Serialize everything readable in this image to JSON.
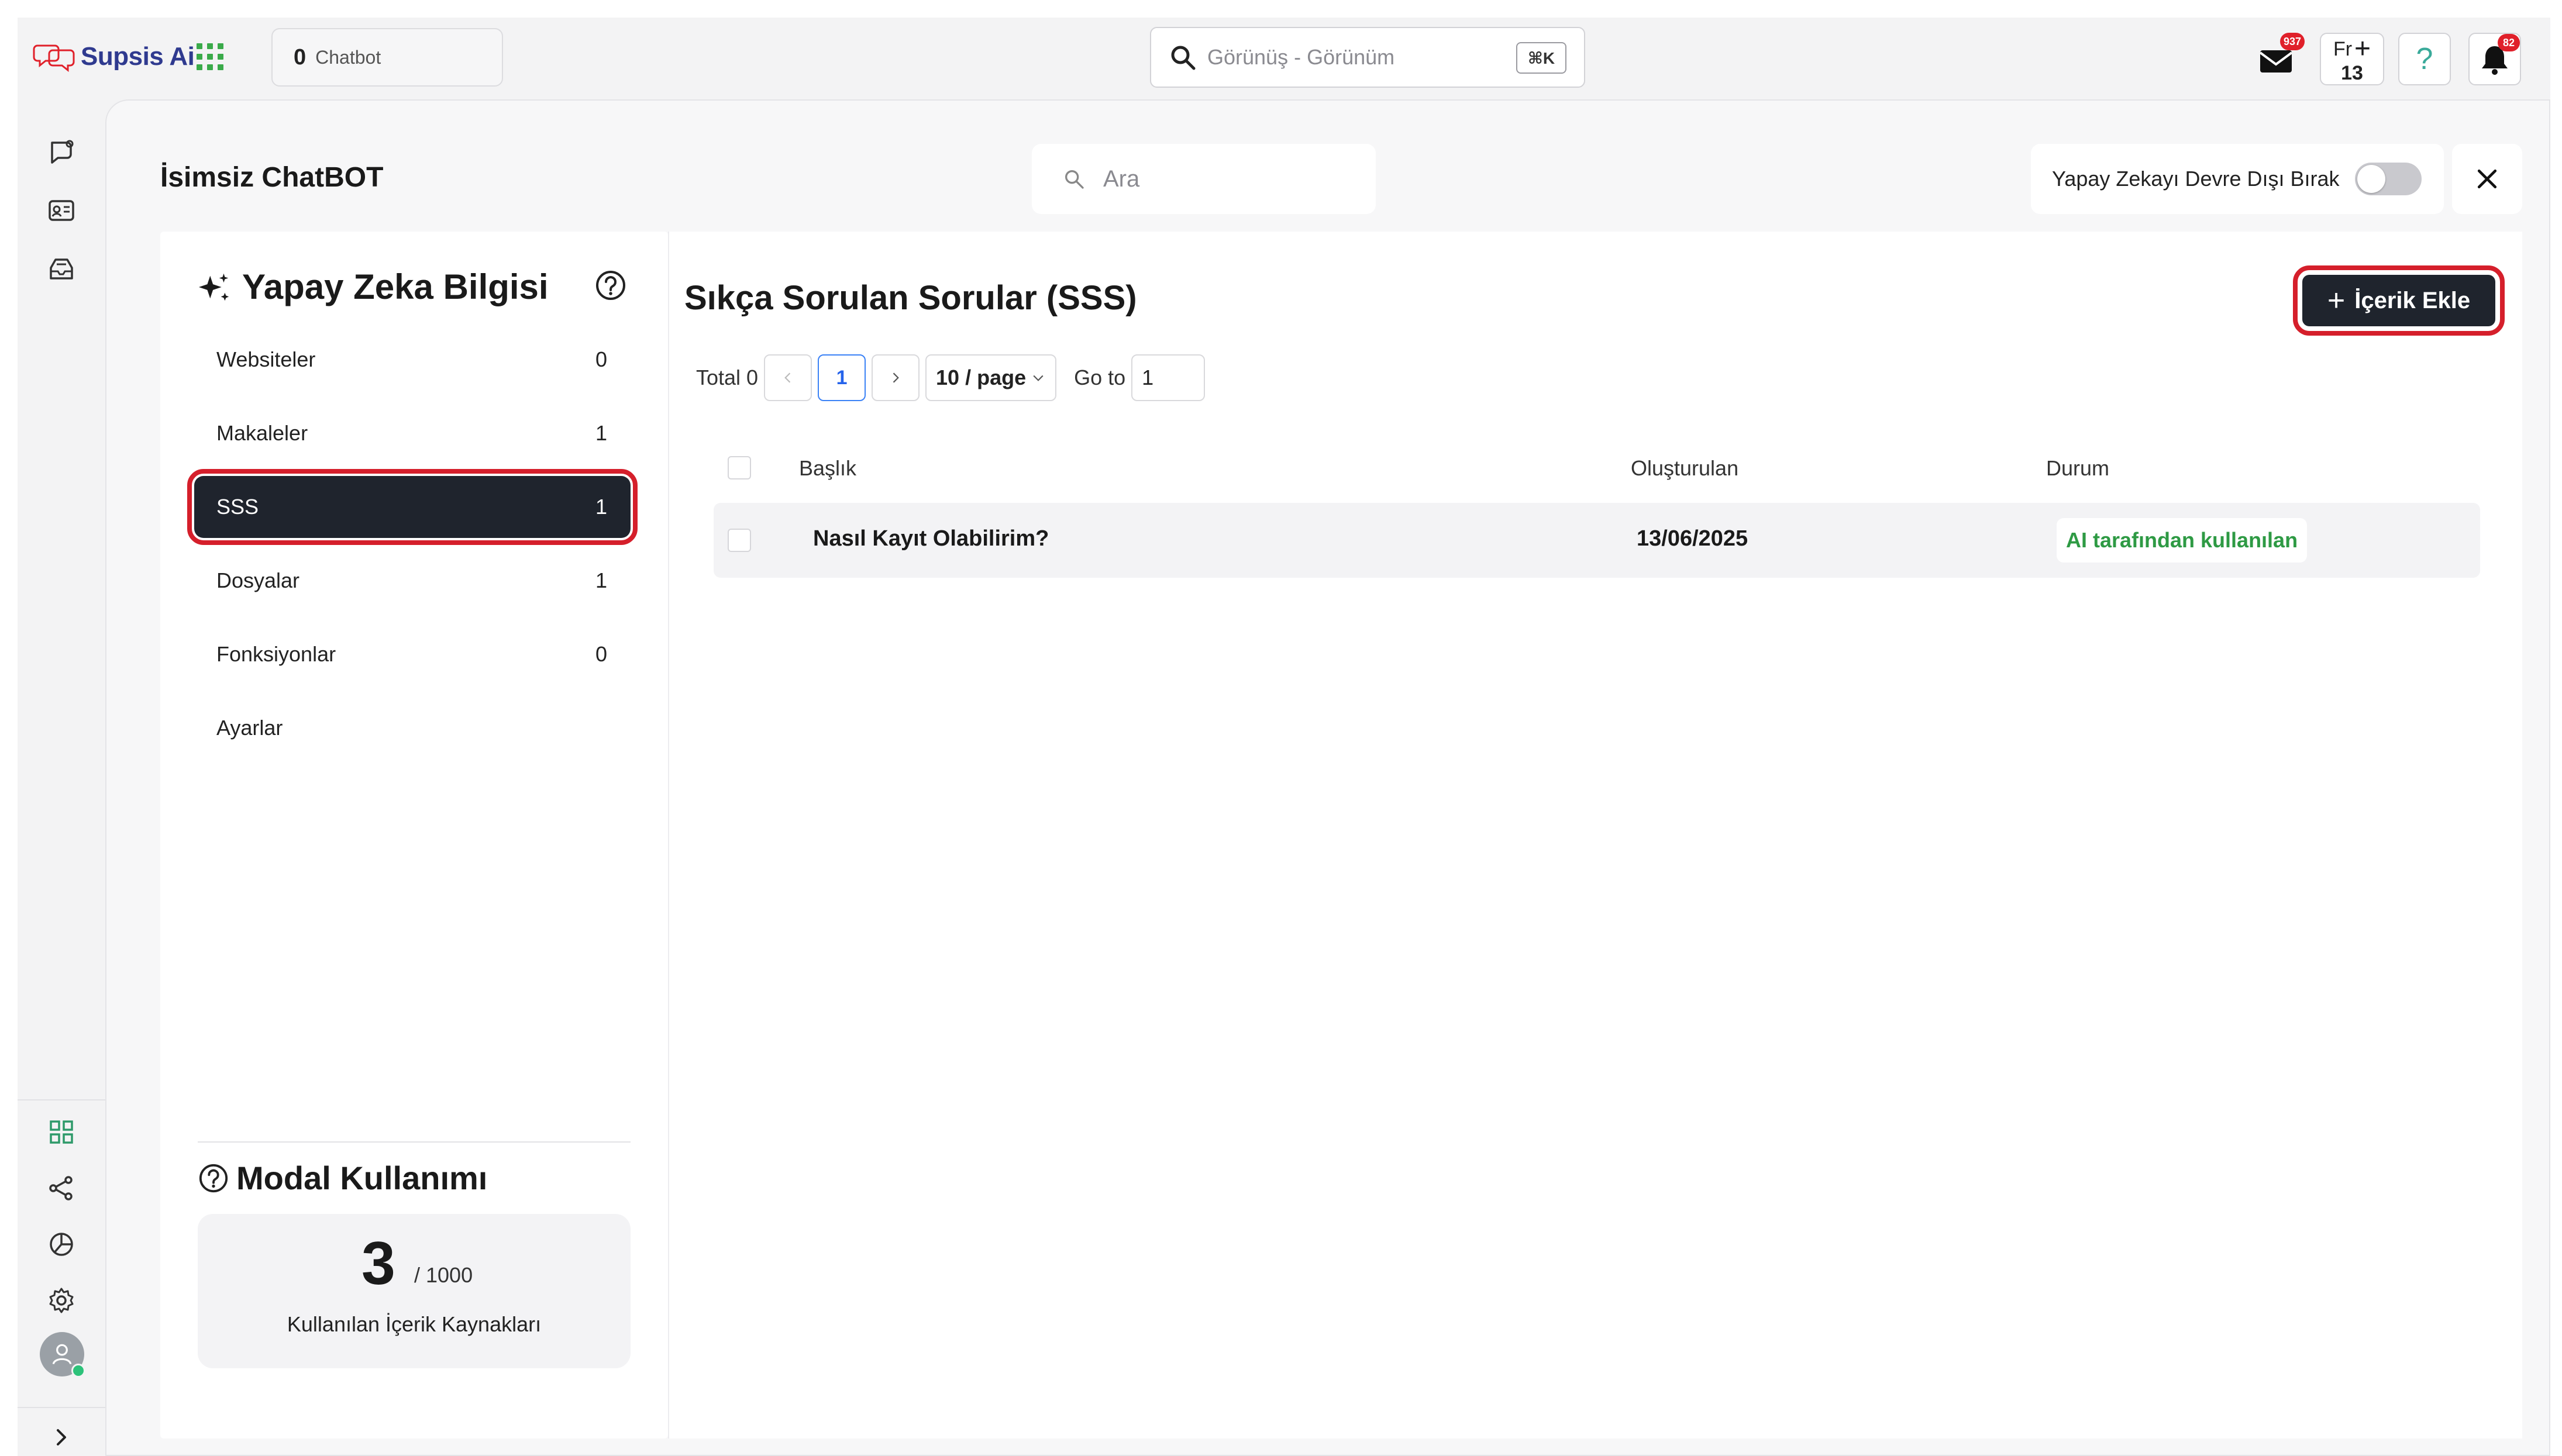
{
  "app": {
    "brand": "Supsis Ai"
  },
  "topbar": {
    "chatbot_count": "0",
    "chatbot_label": "Chatbot",
    "search_placeholder": "Görünüş - Görünüm",
    "shortcut": "⌘K",
    "mail_badge": "937",
    "fr_line1": "Fr",
    "fr_line2": "13",
    "help_glyph": "?",
    "bell_badge": "82"
  },
  "page": {
    "title": "İsimsiz ChatBOT",
    "search_placeholder": "Ara",
    "ai_toggle_label": "Yapay Zekayı Devre Dışı Bırak",
    "ai_toggle_on": false
  },
  "sidebar": {
    "title": "Yapay Zeka Bilgisi",
    "items": [
      {
        "label": "Websiteler",
        "count": "0",
        "active": false
      },
      {
        "label": "Makaleler",
        "count": "1",
        "active": false
      },
      {
        "label": "SSS",
        "count": "1",
        "active": true
      },
      {
        "label": "Dosyalar",
        "count": "1",
        "active": false
      },
      {
        "label": "Fonksiyonlar",
        "count": "0",
        "active": false
      },
      {
        "label": "Ayarlar",
        "count": "",
        "active": false
      }
    ],
    "usage_title": "Modal Kullanımı",
    "usage_value": "3",
    "usage_max": "/ 1000",
    "usage_caption": "Kullanılan İçerik Kaynakları"
  },
  "content": {
    "title": "Sıkça Sorulan Sorular (SSS)",
    "add_button": "İçerik Ekle",
    "pager": {
      "total": "Total 0",
      "current_page": "1",
      "page_size": "10 / page",
      "goto_label": "Go to",
      "goto_value": "1"
    },
    "columns": [
      "Başlık",
      "Oluşturulan",
      "Durum"
    ],
    "rows": [
      {
        "title": "Nasıl Kayıt Olabilirim?",
        "created": "13/06/2025",
        "status": "AI tarafından kullanılan"
      }
    ]
  },
  "colors": {
    "brand": "#2f3a8f",
    "dark": "#1f242d",
    "highlight": "#d51f2b",
    "status_green": "#2e9a44",
    "badge_red": "#e0202a"
  }
}
